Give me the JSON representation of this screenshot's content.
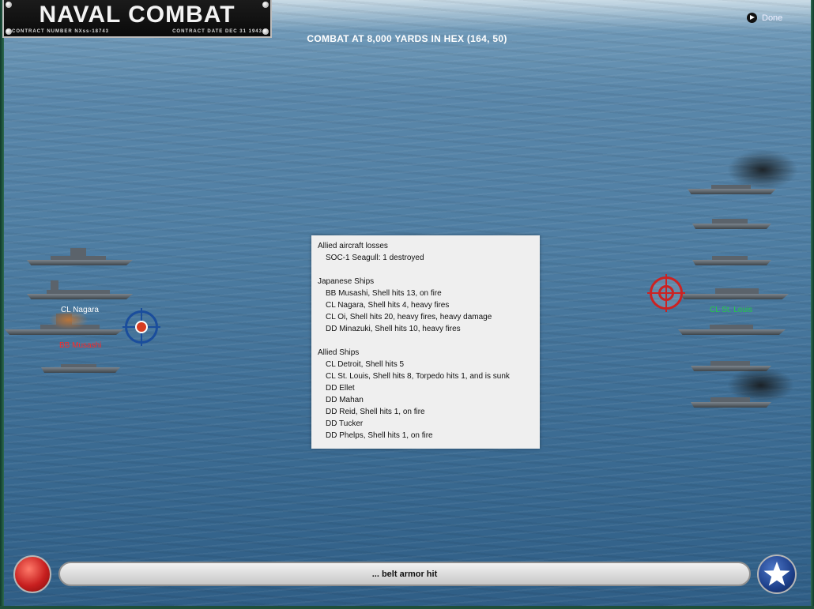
{
  "logo": {
    "title": "NAVAL COMBAT",
    "contract_number": "CONTRACT NUMBER   NXss-18743",
    "contract_date": "CONTRACT DATE  DEC  31  1943"
  },
  "done_label": "Done",
  "header": "COMBAT AT 8,000 YARDS IN HEX (164, 50)",
  "labels": {
    "nagara": "CL Nagara",
    "musashi": "BB Musashi",
    "stlouis": "CL St. Louis"
  },
  "colors": {
    "japanese_label": "#ffffff",
    "targeted_label": "#ff2a2a",
    "allied_label": "#22cc44"
  },
  "report": {
    "lines": [
      {
        "text": "Allied aircraft losses",
        "indent": false
      },
      {
        "text": "SOC-1 Seagull: 1 destroyed",
        "indent": true
      },
      {
        "text": "",
        "indent": false
      },
      {
        "text": "Japanese Ships",
        "indent": false
      },
      {
        "text": "BB Musashi, Shell hits 13,  on fire",
        "indent": true
      },
      {
        "text": "CL Nagara, Shell hits 4,  heavy fires",
        "indent": true
      },
      {
        "text": "CL Oi, Shell hits 20,  heavy fires,  heavy damage",
        "indent": true
      },
      {
        "text": "DD Minazuki, Shell hits 10,  heavy fires",
        "indent": true
      },
      {
        "text": "",
        "indent": false
      },
      {
        "text": "Allied Ships",
        "indent": false
      },
      {
        "text": "CL Detroit, Shell hits 5",
        "indent": true
      },
      {
        "text": "CL St. Louis, Shell hits 8, Torpedo hits 1, and is sunk",
        "indent": true
      },
      {
        "text": "DD Ellet",
        "indent": true
      },
      {
        "text": "DD Mahan",
        "indent": true
      },
      {
        "text": "DD Reid, Shell hits 1,  on fire",
        "indent": true
      },
      {
        "text": "DD Tucker",
        "indent": true
      },
      {
        "text": "DD Phelps, Shell hits 1,  on fire",
        "indent": true
      }
    ]
  },
  "message": "... belt armor hit",
  "icons": {
    "done": "play-circle-icon",
    "left_button": "red-ball-icon",
    "right_button": "us-star-icon"
  }
}
